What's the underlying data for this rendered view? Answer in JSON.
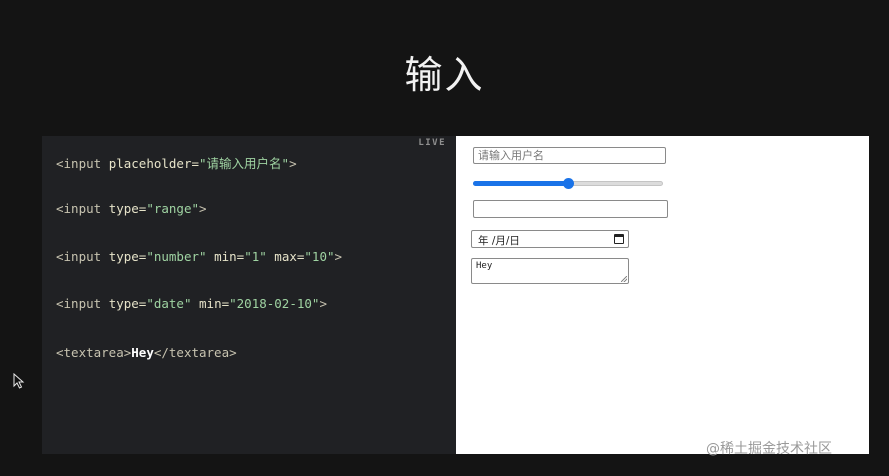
{
  "slide": {
    "title": "输入"
  },
  "code_panel": {
    "live_label": "LIVE",
    "lines": [
      [
        [
          "tag",
          "<input "
        ],
        [
          "attr",
          "placeholder="
        ],
        [
          "val",
          "\"请输入用户名\""
        ],
        [
          "tag",
          ">"
        ]
      ],
      [
        [
          "tag",
          "<input "
        ],
        [
          "attr",
          "type="
        ],
        [
          "val",
          "\"range\""
        ],
        [
          "tag",
          ">"
        ]
      ],
      [
        [
          "tag",
          "<input "
        ],
        [
          "attr",
          "type="
        ],
        [
          "val",
          "\"number\""
        ],
        [
          "tag",
          " "
        ],
        [
          "attr",
          "min="
        ],
        [
          "val",
          "\"1\""
        ],
        [
          "tag",
          " "
        ],
        [
          "attr",
          "max="
        ],
        [
          "val",
          "\"10\""
        ],
        [
          "tag",
          ">"
        ]
      ],
      [
        [
          "tag",
          "<input "
        ],
        [
          "attr",
          "type="
        ],
        [
          "val",
          "\"date\""
        ],
        [
          "tag",
          " "
        ],
        [
          "attr",
          "min="
        ],
        [
          "val",
          "\"2018-02-10\""
        ],
        [
          "tag",
          ">"
        ]
      ],
      [
        [
          "tag",
          "<textarea>"
        ],
        [
          "txt",
          "Hey"
        ],
        [
          "tag",
          "</textarea>"
        ]
      ]
    ]
  },
  "preview": {
    "text_input": {
      "placeholder": "请输入用户名",
      "value": ""
    },
    "range_input": {
      "value_fraction": 0.5
    },
    "number_input": {
      "value": ""
    },
    "date_input": {
      "display": "年 /月/日",
      "icon": "calendar-icon"
    },
    "textarea": {
      "value": "Hey"
    }
  },
  "watermark": {
    "text": "@稀土掘金技术社区"
  },
  "cursor": {
    "icon": "mouse-pointer-icon"
  }
}
